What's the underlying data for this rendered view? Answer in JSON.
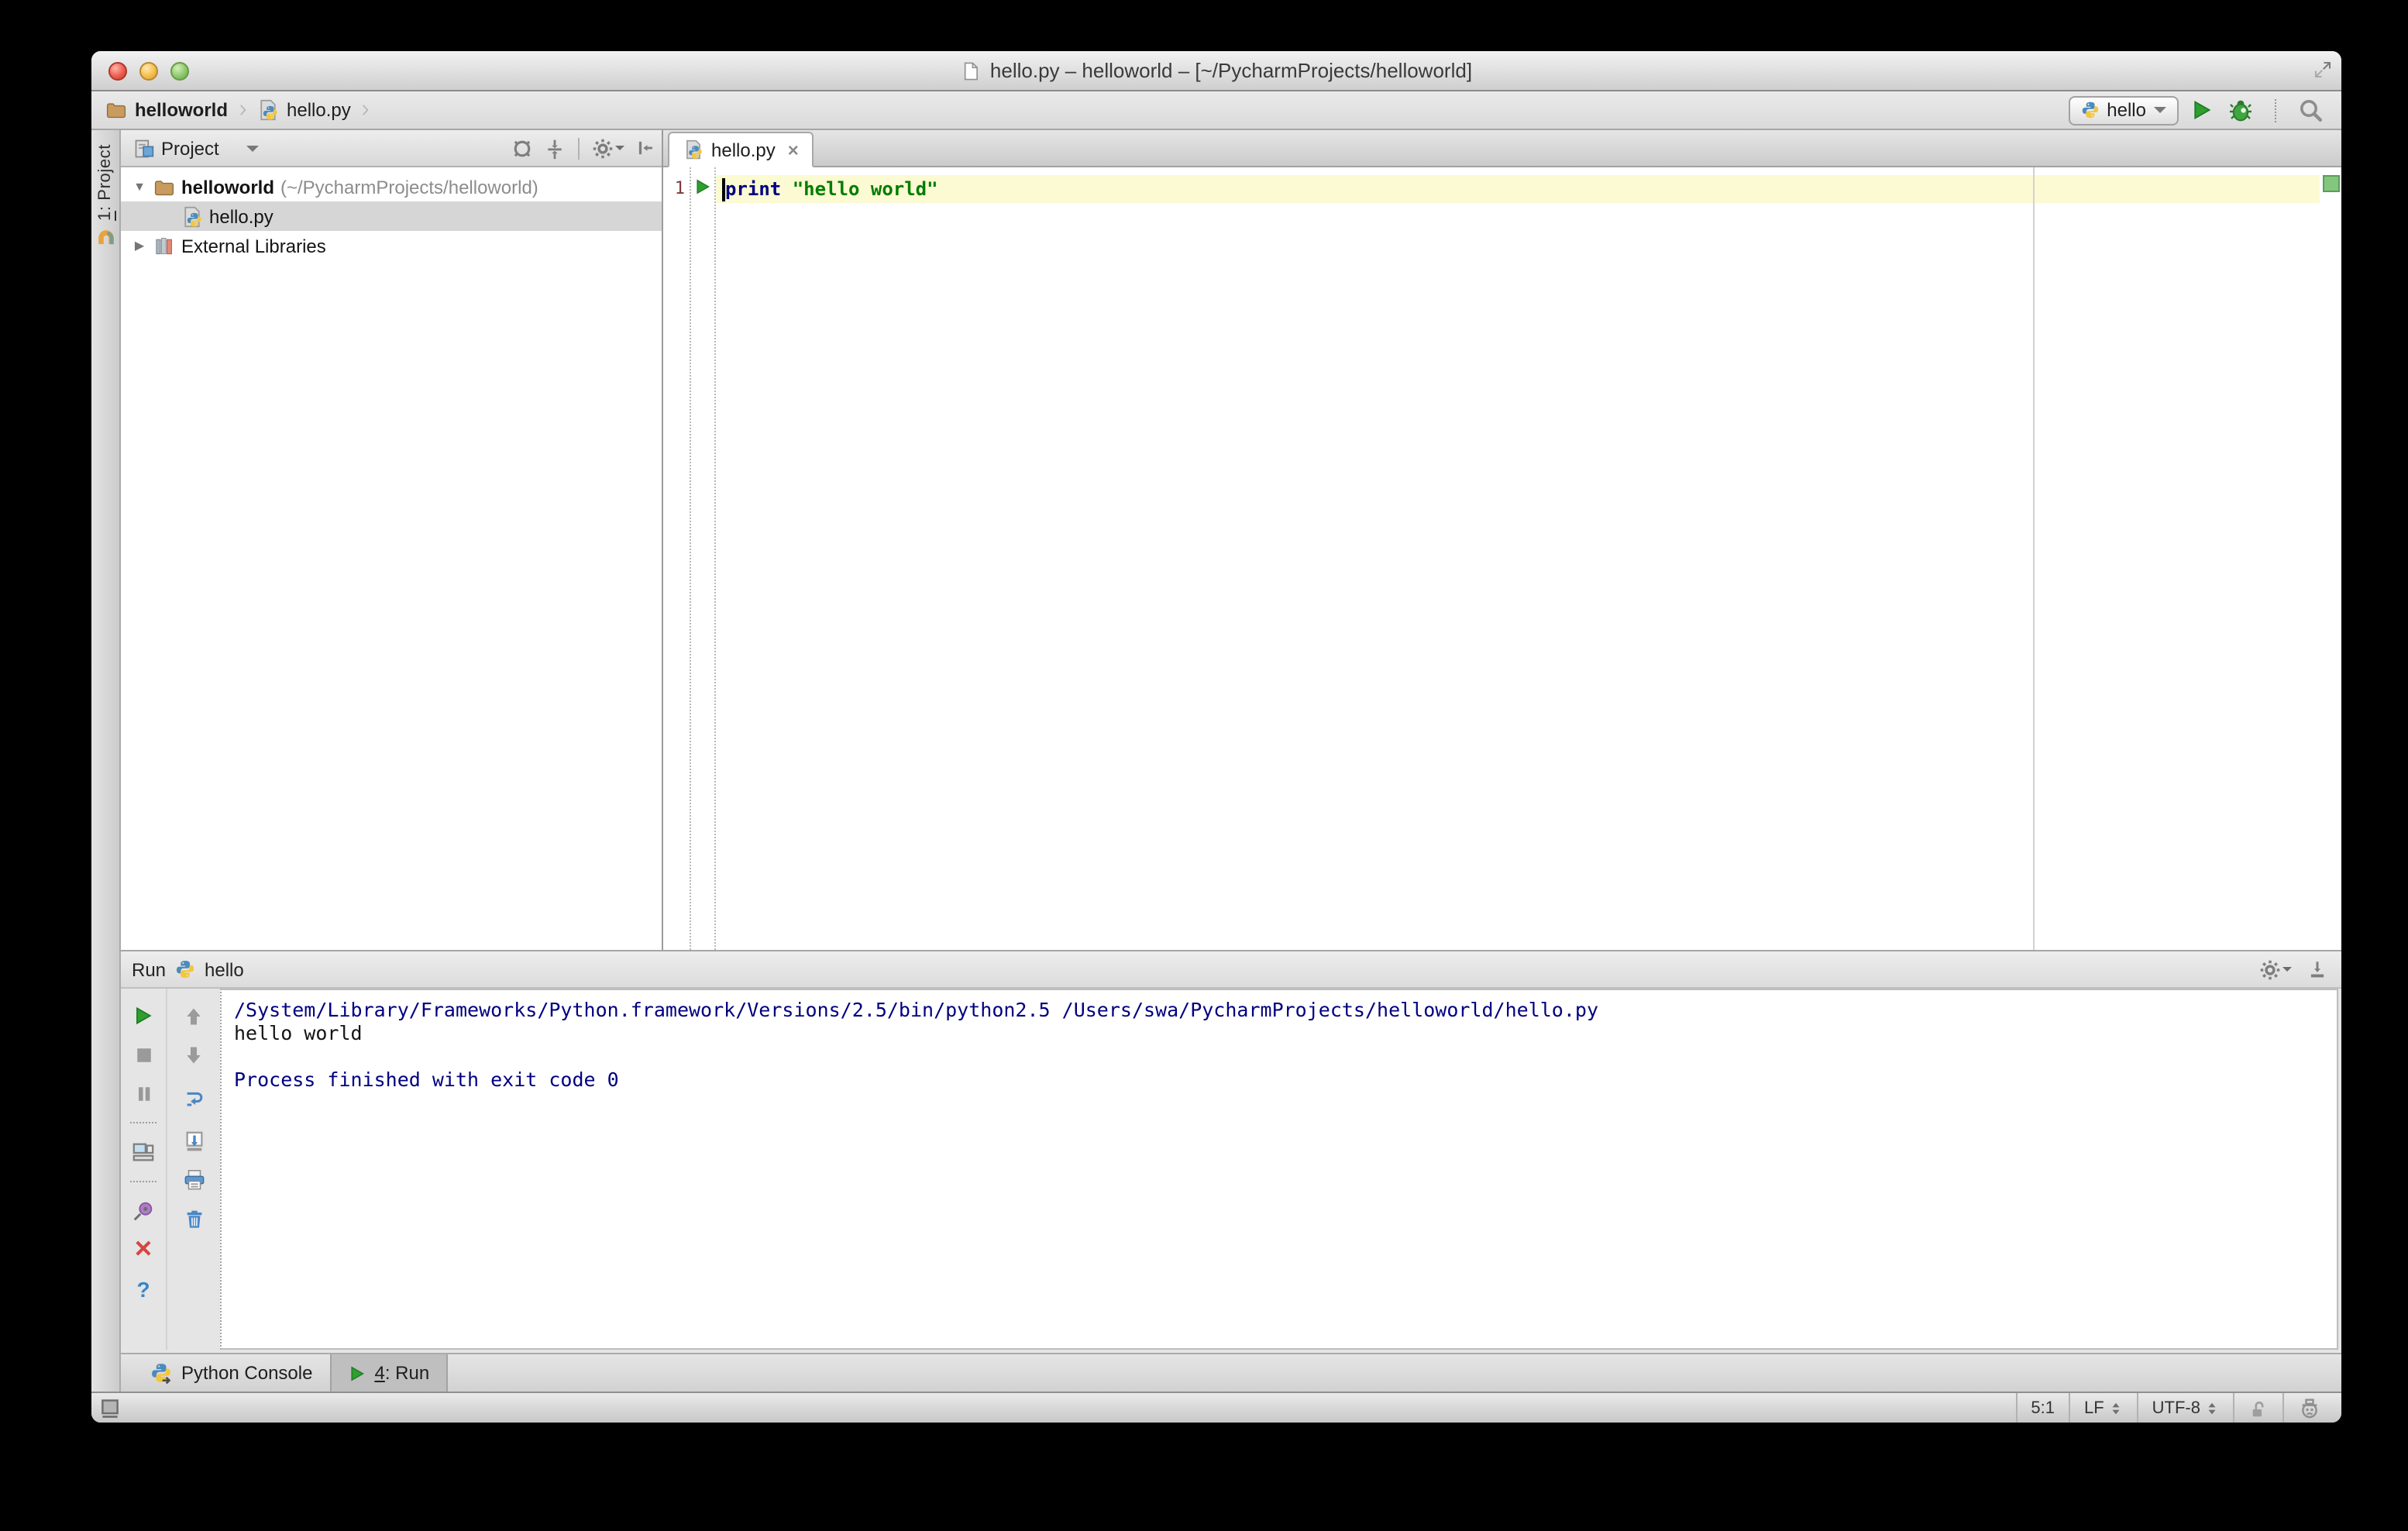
{
  "window": {
    "title": "hello.py – helloworld – [~/PycharmProjects/helloworld]"
  },
  "navbar": {
    "breadcrumbs": {
      "project": "helloworld",
      "file": "hello.py"
    },
    "run_config": "hello"
  },
  "tool_strip": {
    "project_tab": {
      "shortcut": "1",
      "rest": ": Project"
    }
  },
  "project_panel": {
    "title": "Project",
    "tree": {
      "root": {
        "name": "helloworld",
        "path": "(~/PycharmProjects/helloworld)"
      },
      "file": {
        "name": "hello.py"
      },
      "libraries": {
        "name": "External Libraries"
      }
    }
  },
  "editor": {
    "tab": "hello.py",
    "line_number": "1",
    "code": {
      "keyword": "print",
      "string": "\"hello world\""
    }
  },
  "run_panel": {
    "title": "Run",
    "config_name": "hello",
    "console": [
      {
        "text": "/System/Library/Frameworks/Python.framework/Versions/2.5/bin/python2.5 /Users/swa/PycharmProjects/helloworld/hello.py",
        "type": "system"
      },
      {
        "text": "hello world",
        "type": "stdout"
      },
      {
        "text": "",
        "type": "stdout"
      },
      {
        "text": "Process finished with exit code 0",
        "type": "system"
      }
    ]
  },
  "bottom_tabs": {
    "python_console": "Python Console",
    "run": {
      "shortcut": "4",
      "rest": ": Run"
    }
  },
  "status_bar": {
    "caret_position": "5:1",
    "line_separator": "LF",
    "encoding": "UTF-8"
  },
  "colors": {
    "keyword": "#000080",
    "string": "#007D00",
    "console_system": "#000080",
    "current_line_bg": "#FBFAD2",
    "tree_selection_bg": "#D6D6D6",
    "run_green": "#2F9E2F",
    "inspection_ok": "#82C77D",
    "line_number": "#7A3B3B"
  }
}
